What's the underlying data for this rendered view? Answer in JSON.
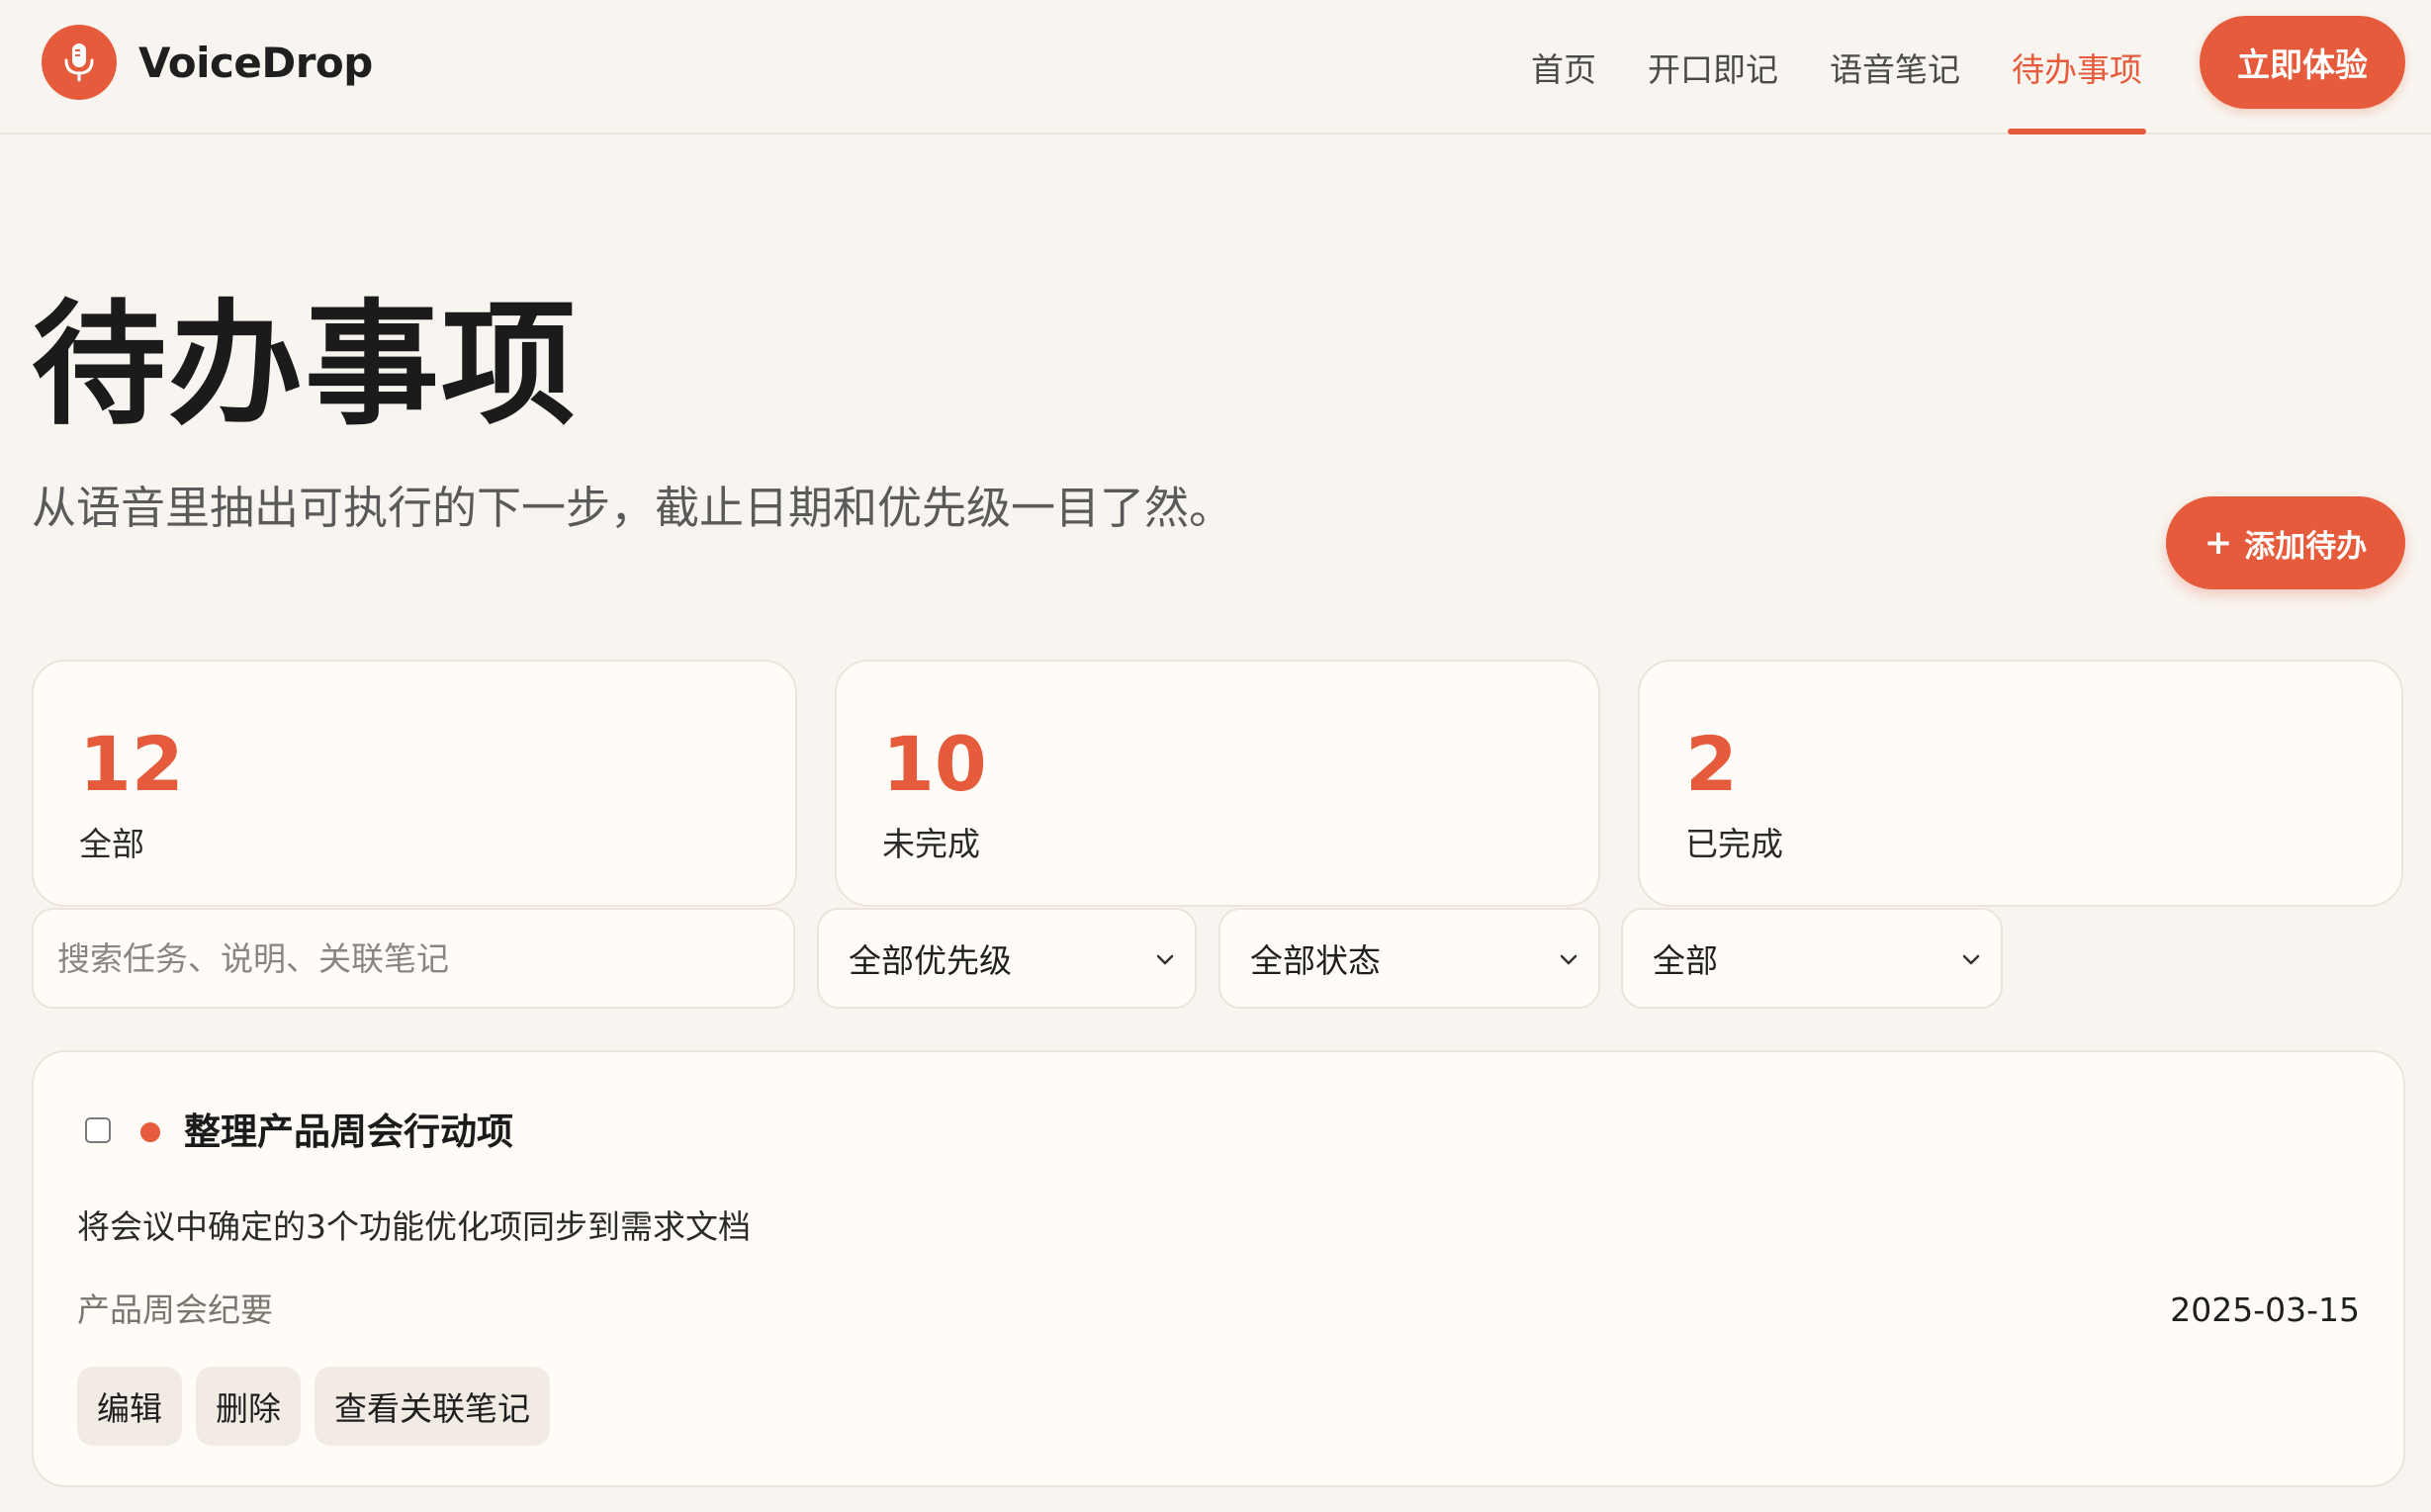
{
  "app": {
    "name": "VoiceDrop"
  },
  "nav": {
    "items": [
      {
        "label": "首页",
        "active": false
      },
      {
        "label": "开口即记",
        "active": false
      },
      {
        "label": "语音笔记",
        "active": false
      },
      {
        "label": "待办事项",
        "active": true
      }
    ],
    "cta_label": "立即体验"
  },
  "hero": {
    "title": "待办事项",
    "subtitle": "从语音里抽出可执行的下一步，截止日期和优先级一目了然。",
    "add_label": "添加待办",
    "add_prefix": "+"
  },
  "stats": [
    {
      "value": "12",
      "label": "全部"
    },
    {
      "value": "10",
      "label": "未完成"
    },
    {
      "value": "2",
      "label": "已完成"
    }
  ],
  "filters": {
    "search_placeholder": "搜索任务、说明、关联笔记",
    "priority": "全部优先级",
    "status": "全部状态",
    "range": "全部"
  },
  "todos": [
    {
      "title": "整理产品周会行动项",
      "description": "将会议中确定的3个功能优化项同步到需求文档",
      "note": "产品周会纪要",
      "due": "2025-03-15",
      "completed": false,
      "priority_color": "#e55b3c",
      "actions": {
        "edit": "编辑",
        "delete": "删除",
        "view_note": "查看关联笔记"
      }
    }
  ],
  "colors": {
    "accent": "#e55b3c",
    "background": "#f8f5f0",
    "card": "#fffcf7"
  },
  "icons": {
    "logo": "microphone-icon",
    "chevron": "chevron-down-icon"
  }
}
